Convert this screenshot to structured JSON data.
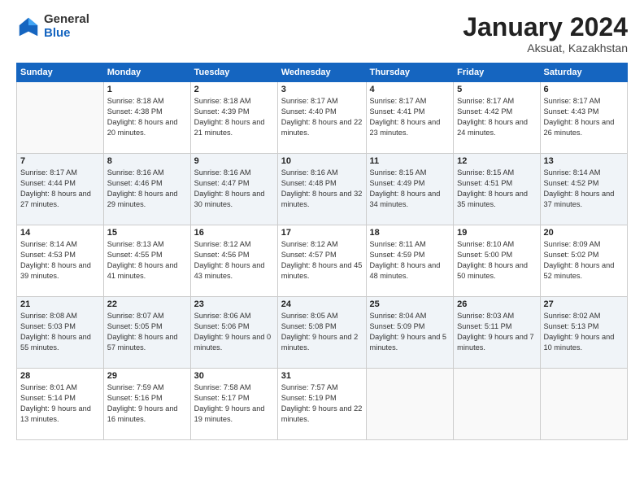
{
  "header": {
    "logo_general": "General",
    "logo_blue": "Blue",
    "title": "January 2024",
    "location": "Aksuat, Kazakhstan"
  },
  "weekdays": [
    "Sunday",
    "Monday",
    "Tuesday",
    "Wednesday",
    "Thursday",
    "Friday",
    "Saturday"
  ],
  "weeks": [
    [
      {
        "day": "",
        "sunrise": "",
        "sunset": "",
        "daylight": ""
      },
      {
        "day": "1",
        "sunrise": "Sunrise: 8:18 AM",
        "sunset": "Sunset: 4:38 PM",
        "daylight": "Daylight: 8 hours and 20 minutes."
      },
      {
        "day": "2",
        "sunrise": "Sunrise: 8:18 AM",
        "sunset": "Sunset: 4:39 PM",
        "daylight": "Daylight: 8 hours and 21 minutes."
      },
      {
        "day": "3",
        "sunrise": "Sunrise: 8:17 AM",
        "sunset": "Sunset: 4:40 PM",
        "daylight": "Daylight: 8 hours and 22 minutes."
      },
      {
        "day": "4",
        "sunrise": "Sunrise: 8:17 AM",
        "sunset": "Sunset: 4:41 PM",
        "daylight": "Daylight: 8 hours and 23 minutes."
      },
      {
        "day": "5",
        "sunrise": "Sunrise: 8:17 AM",
        "sunset": "Sunset: 4:42 PM",
        "daylight": "Daylight: 8 hours and 24 minutes."
      },
      {
        "day": "6",
        "sunrise": "Sunrise: 8:17 AM",
        "sunset": "Sunset: 4:43 PM",
        "daylight": "Daylight: 8 hours and 26 minutes."
      }
    ],
    [
      {
        "day": "7",
        "sunrise": "Sunrise: 8:17 AM",
        "sunset": "Sunset: 4:44 PM",
        "daylight": "Daylight: 8 hours and 27 minutes."
      },
      {
        "day": "8",
        "sunrise": "Sunrise: 8:16 AM",
        "sunset": "Sunset: 4:46 PM",
        "daylight": "Daylight: 8 hours and 29 minutes."
      },
      {
        "day": "9",
        "sunrise": "Sunrise: 8:16 AM",
        "sunset": "Sunset: 4:47 PM",
        "daylight": "Daylight: 8 hours and 30 minutes."
      },
      {
        "day": "10",
        "sunrise": "Sunrise: 8:16 AM",
        "sunset": "Sunset: 4:48 PM",
        "daylight": "Daylight: 8 hours and 32 minutes."
      },
      {
        "day": "11",
        "sunrise": "Sunrise: 8:15 AM",
        "sunset": "Sunset: 4:49 PM",
        "daylight": "Daylight: 8 hours and 34 minutes."
      },
      {
        "day": "12",
        "sunrise": "Sunrise: 8:15 AM",
        "sunset": "Sunset: 4:51 PM",
        "daylight": "Daylight: 8 hours and 35 minutes."
      },
      {
        "day": "13",
        "sunrise": "Sunrise: 8:14 AM",
        "sunset": "Sunset: 4:52 PM",
        "daylight": "Daylight: 8 hours and 37 minutes."
      }
    ],
    [
      {
        "day": "14",
        "sunrise": "Sunrise: 8:14 AM",
        "sunset": "Sunset: 4:53 PM",
        "daylight": "Daylight: 8 hours and 39 minutes."
      },
      {
        "day": "15",
        "sunrise": "Sunrise: 8:13 AM",
        "sunset": "Sunset: 4:55 PM",
        "daylight": "Daylight: 8 hours and 41 minutes."
      },
      {
        "day": "16",
        "sunrise": "Sunrise: 8:12 AM",
        "sunset": "Sunset: 4:56 PM",
        "daylight": "Daylight: 8 hours and 43 minutes."
      },
      {
        "day": "17",
        "sunrise": "Sunrise: 8:12 AM",
        "sunset": "Sunset: 4:57 PM",
        "daylight": "Daylight: 8 hours and 45 minutes."
      },
      {
        "day": "18",
        "sunrise": "Sunrise: 8:11 AM",
        "sunset": "Sunset: 4:59 PM",
        "daylight": "Daylight: 8 hours and 48 minutes."
      },
      {
        "day": "19",
        "sunrise": "Sunrise: 8:10 AM",
        "sunset": "Sunset: 5:00 PM",
        "daylight": "Daylight: 8 hours and 50 minutes."
      },
      {
        "day": "20",
        "sunrise": "Sunrise: 8:09 AM",
        "sunset": "Sunset: 5:02 PM",
        "daylight": "Daylight: 8 hours and 52 minutes."
      }
    ],
    [
      {
        "day": "21",
        "sunrise": "Sunrise: 8:08 AM",
        "sunset": "Sunset: 5:03 PM",
        "daylight": "Daylight: 8 hours and 55 minutes."
      },
      {
        "day": "22",
        "sunrise": "Sunrise: 8:07 AM",
        "sunset": "Sunset: 5:05 PM",
        "daylight": "Daylight: 8 hours and 57 minutes."
      },
      {
        "day": "23",
        "sunrise": "Sunrise: 8:06 AM",
        "sunset": "Sunset: 5:06 PM",
        "daylight": "Daylight: 9 hours and 0 minutes."
      },
      {
        "day": "24",
        "sunrise": "Sunrise: 8:05 AM",
        "sunset": "Sunset: 5:08 PM",
        "daylight": "Daylight: 9 hours and 2 minutes."
      },
      {
        "day": "25",
        "sunrise": "Sunrise: 8:04 AM",
        "sunset": "Sunset: 5:09 PM",
        "daylight": "Daylight: 9 hours and 5 minutes."
      },
      {
        "day": "26",
        "sunrise": "Sunrise: 8:03 AM",
        "sunset": "Sunset: 5:11 PM",
        "daylight": "Daylight: 9 hours and 7 minutes."
      },
      {
        "day": "27",
        "sunrise": "Sunrise: 8:02 AM",
        "sunset": "Sunset: 5:13 PM",
        "daylight": "Daylight: 9 hours and 10 minutes."
      }
    ],
    [
      {
        "day": "28",
        "sunrise": "Sunrise: 8:01 AM",
        "sunset": "Sunset: 5:14 PM",
        "daylight": "Daylight: 9 hours and 13 minutes."
      },
      {
        "day": "29",
        "sunrise": "Sunrise: 7:59 AM",
        "sunset": "Sunset: 5:16 PM",
        "daylight": "Daylight: 9 hours and 16 minutes."
      },
      {
        "day": "30",
        "sunrise": "Sunrise: 7:58 AM",
        "sunset": "Sunset: 5:17 PM",
        "daylight": "Daylight: 9 hours and 19 minutes."
      },
      {
        "day": "31",
        "sunrise": "Sunrise: 7:57 AM",
        "sunset": "Sunset: 5:19 PM",
        "daylight": "Daylight: 9 hours and 22 minutes."
      },
      {
        "day": "",
        "sunrise": "",
        "sunset": "",
        "daylight": ""
      },
      {
        "day": "",
        "sunrise": "",
        "sunset": "",
        "daylight": ""
      },
      {
        "day": "",
        "sunrise": "",
        "sunset": "",
        "daylight": ""
      }
    ]
  ]
}
